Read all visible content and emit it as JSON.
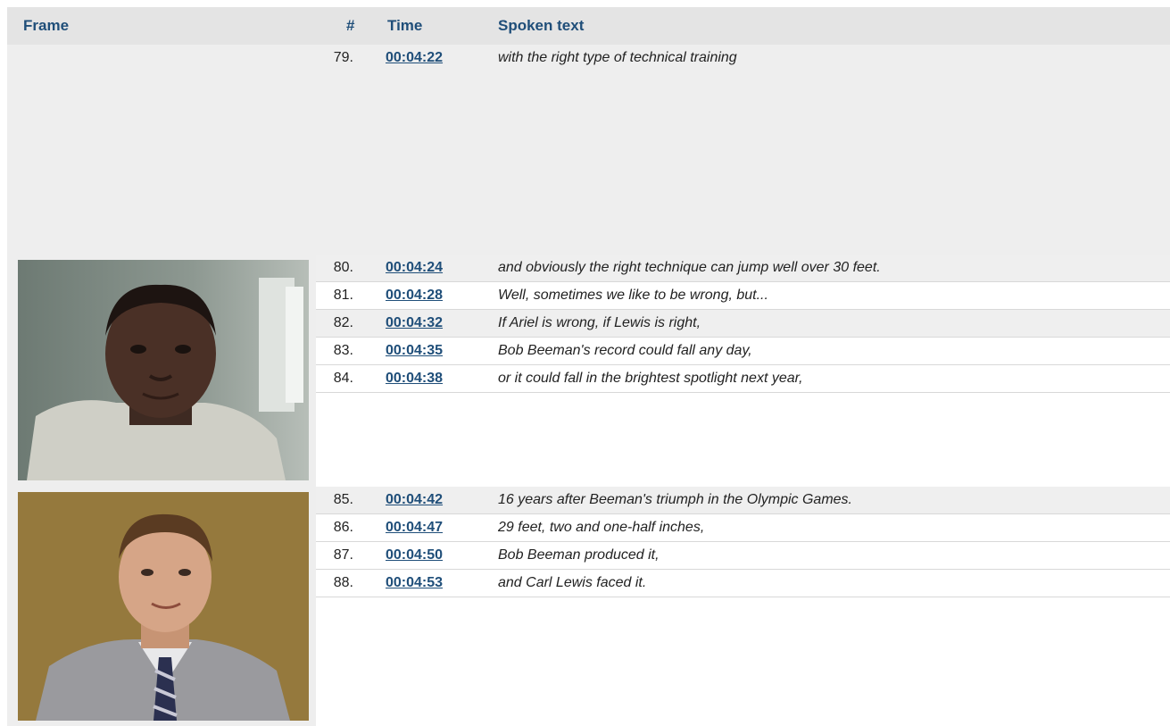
{
  "headers": {
    "frame": "Frame",
    "num": "#",
    "time": "Time",
    "text": "Spoken text"
  },
  "groups": [
    {
      "image": null,
      "rows": [
        {
          "num": "79.",
          "time": "00:04:22",
          "text": "with the right type of technical training"
        }
      ]
    },
    {
      "image": "athlete-portrait",
      "rows": [
        {
          "num": "80.",
          "time": "00:04:24",
          "text": "and obviously the right technique can jump well over 30 feet."
        },
        {
          "num": "81.",
          "time": "00:04:28",
          "text": "Well, sometimes we like to be wrong, but..."
        },
        {
          "num": "82.",
          "time": "00:04:32",
          "text": "If Ariel is wrong, if Lewis is right,"
        },
        {
          "num": "83.",
          "time": "00:04:35",
          "text": "Bob Beeman's record could fall any day,"
        },
        {
          "num": "84.",
          "time": "00:04:38",
          "text": "or it could fall in the brightest spotlight next year,"
        }
      ]
    },
    {
      "image": "reporter-portrait",
      "rows": [
        {
          "num": "85.",
          "time": "00:04:42",
          "text": "16 years after Beeman's triumph in the Olympic Games."
        },
        {
          "num": "86.",
          "time": "00:04:47",
          "text": "29 feet, two and one-half inches,"
        },
        {
          "num": "87.",
          "time": "00:04:50",
          "text": "Bob Beeman produced it,"
        },
        {
          "num": "88.",
          "time": "00:04:53",
          "text": "and Carl Lewis faced it."
        }
      ]
    }
  ]
}
